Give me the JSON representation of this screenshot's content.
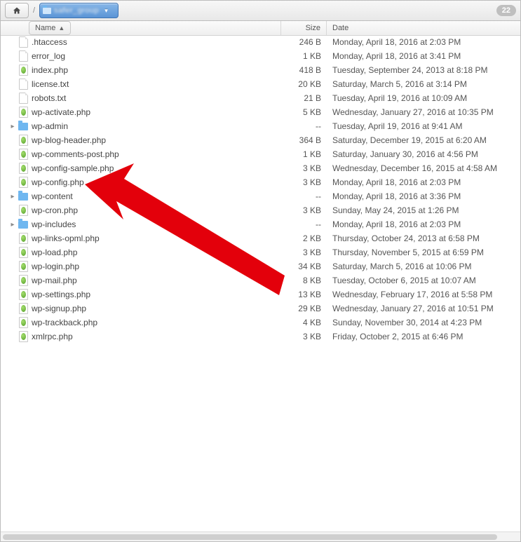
{
  "toolbar": {
    "home_icon": "home-icon",
    "separator": "/",
    "folder_icon": "folder-icon",
    "folder_label": "safer_group",
    "dropdown_icon": "chevron-down-icon",
    "badge_count": "22"
  },
  "columns": {
    "name": "Name",
    "size": "Size",
    "date": "Date",
    "sort_indicator": "▲"
  },
  "folder_dash": "--",
  "files": [
    {
      "kind": "file",
      "name": ".htaccess",
      "size": "246 B",
      "date": "Monday, April 18, 2016 at 2:03 PM"
    },
    {
      "kind": "file",
      "name": "error_log",
      "size": "1 KB",
      "date": "Monday, April 18, 2016 at 3:41 PM"
    },
    {
      "kind": "php",
      "name": "index.php",
      "size": "418 B",
      "date": "Tuesday, September 24, 2013 at 8:18 PM"
    },
    {
      "kind": "file",
      "name": "license.txt",
      "size": "20 KB",
      "date": "Saturday, March 5, 2016 at 3:14 PM"
    },
    {
      "kind": "file",
      "name": "robots.txt",
      "size": "21 B",
      "date": "Tuesday, April 19, 2016 at 10:09 AM"
    },
    {
      "kind": "php",
      "name": "wp-activate.php",
      "size": "5 KB",
      "date": "Wednesday, January 27, 2016 at 10:35 PM"
    },
    {
      "kind": "folder",
      "name": "wp-admin",
      "size": "--",
      "date": "Tuesday, April 19, 2016 at 9:41 AM"
    },
    {
      "kind": "php",
      "name": "wp-blog-header.php",
      "size": "364 B",
      "date": "Saturday, December 19, 2015 at 6:20 AM"
    },
    {
      "kind": "php",
      "name": "wp-comments-post.php",
      "size": "1 KB",
      "date": "Saturday, January 30, 2016 at 4:56 PM"
    },
    {
      "kind": "php",
      "name": "wp-config-sample.php",
      "size": "3 KB",
      "date": "Wednesday, December 16, 2015 at 4:58 AM"
    },
    {
      "kind": "php",
      "name": "wp-config.php",
      "size": "3 KB",
      "date": "Monday, April 18, 2016 at 2:03 PM"
    },
    {
      "kind": "folder",
      "name": "wp-content",
      "size": "--",
      "date": "Monday, April 18, 2016 at 3:36 PM"
    },
    {
      "kind": "php",
      "name": "wp-cron.php",
      "size": "3 KB",
      "date": "Sunday, May 24, 2015 at 1:26 PM"
    },
    {
      "kind": "folder",
      "name": "wp-includes",
      "size": "--",
      "date": "Monday, April 18, 2016 at 2:03 PM"
    },
    {
      "kind": "php",
      "name": "wp-links-opml.php",
      "size": "2 KB",
      "date": "Thursday, October 24, 2013 at 6:58 PM"
    },
    {
      "kind": "php",
      "name": "wp-load.php",
      "size": "3 KB",
      "date": "Thursday, November 5, 2015 at 6:59 PM"
    },
    {
      "kind": "php",
      "name": "wp-login.php",
      "size": "34 KB",
      "date": "Saturday, March 5, 2016 at 10:06 PM"
    },
    {
      "kind": "php",
      "name": "wp-mail.php",
      "size": "8 KB",
      "date": "Tuesday, October 6, 2015 at 10:07 AM"
    },
    {
      "kind": "php",
      "name": "wp-settings.php",
      "size": "13 KB",
      "date": "Wednesday, February 17, 2016 at 5:58 PM"
    },
    {
      "kind": "php",
      "name": "wp-signup.php",
      "size": "29 KB",
      "date": "Wednesday, January 27, 2016 at 10:51 PM"
    },
    {
      "kind": "php",
      "name": "wp-trackback.php",
      "size": "4 KB",
      "date": "Sunday, November 30, 2014 at 4:23 PM"
    },
    {
      "kind": "php",
      "name": "xmlrpc.php",
      "size": "3 KB",
      "date": "Friday, October 2, 2015 at 6:46 PM"
    }
  ],
  "annotation": {
    "type": "arrow",
    "color": "#e3000b",
    "target": "wp-config.php"
  }
}
